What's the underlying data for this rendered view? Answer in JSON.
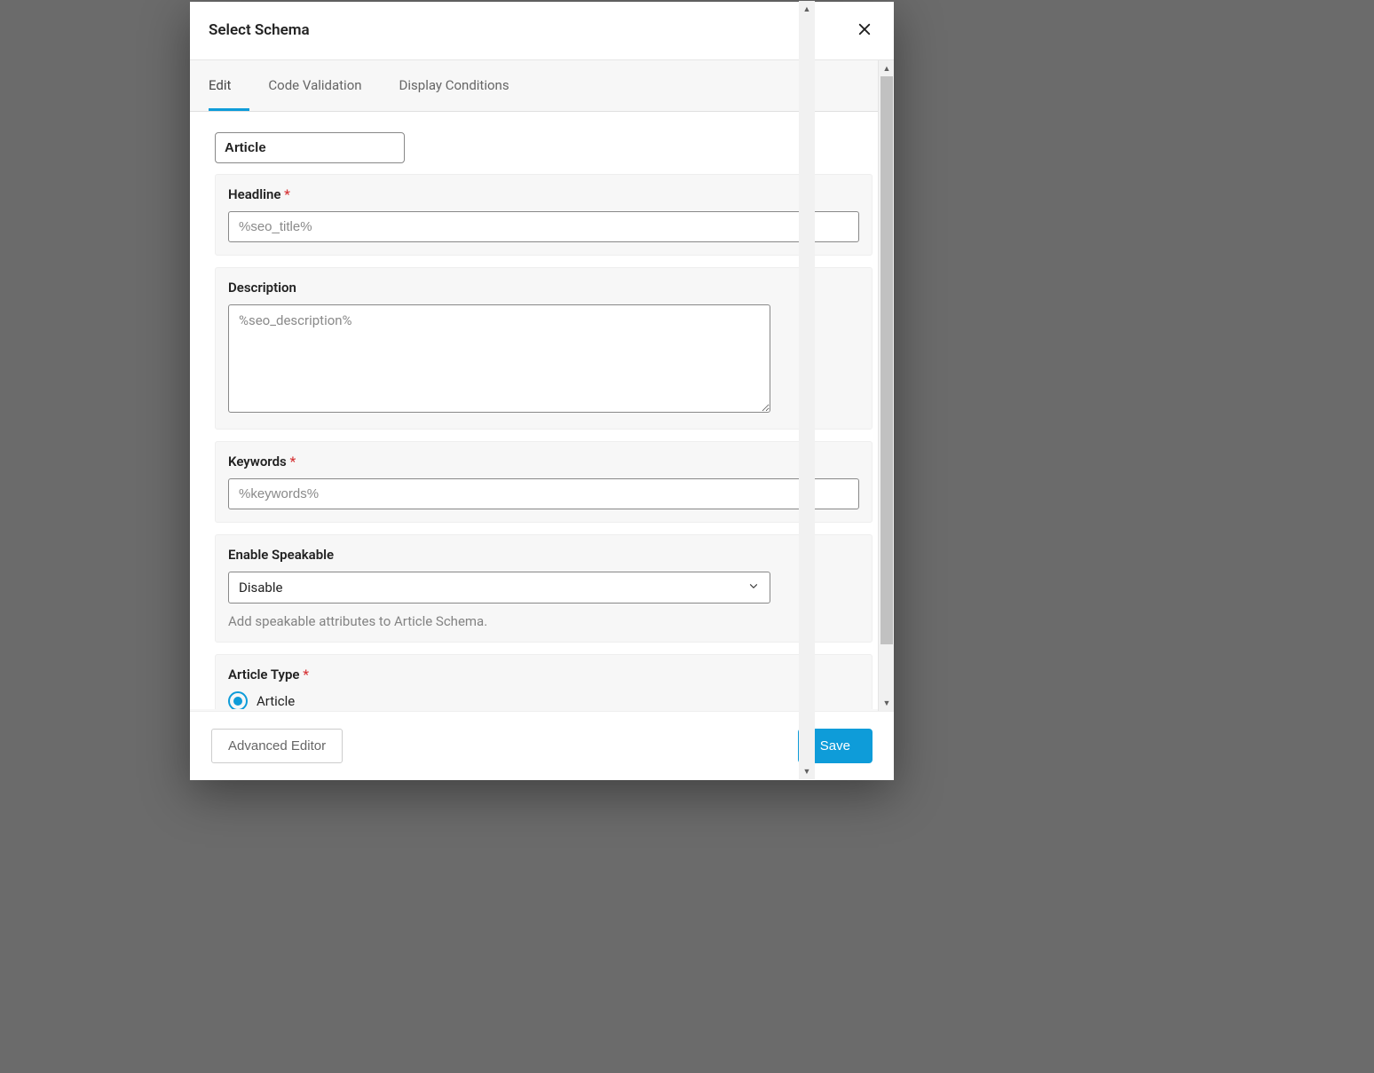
{
  "modal": {
    "title": "Select Schema"
  },
  "tabs": {
    "edit": "Edit",
    "code_validation": "Code Validation",
    "display_conditions": "Display Conditions"
  },
  "schema_type": {
    "value": "Article"
  },
  "fields": {
    "headline": {
      "label": "Headline",
      "placeholder": "%seo_title%"
    },
    "description": {
      "label": "Description",
      "placeholder": "%seo_description%"
    },
    "keywords": {
      "label": "Keywords",
      "placeholder": "%keywords%"
    },
    "enable_speakable": {
      "label": "Enable Speakable",
      "value": "Disable",
      "help": "Add speakable attributes to Article Schema."
    },
    "article_type": {
      "label": "Article Type",
      "options": {
        "article": "Article"
      }
    }
  },
  "footer": {
    "advanced_editor": "Advanced Editor",
    "save": "Save"
  }
}
